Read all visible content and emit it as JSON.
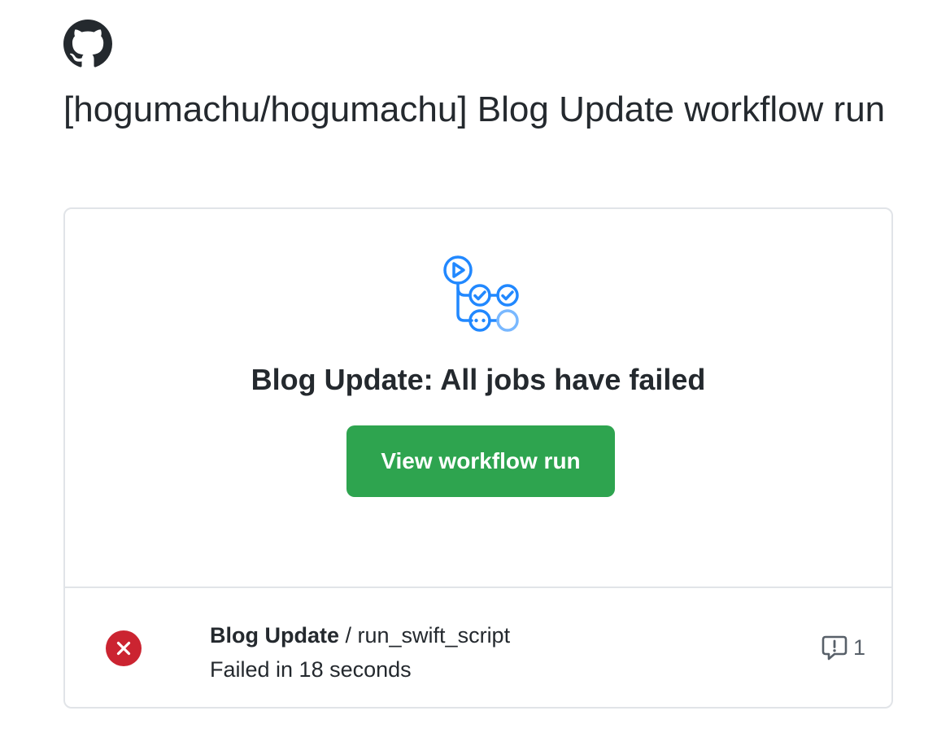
{
  "header": {
    "logo_icon": "github-mark-icon",
    "title": "[hogumachu/hogumachu] Blog Update workflow run"
  },
  "card": {
    "workflow_icon": "actions-workflow-icon",
    "headline": "Blog Update: All jobs have failed",
    "button_label": "View workflow run",
    "colors": {
      "button": "#2ea44f",
      "icon_primary": "#2188ff",
      "icon_secondary": "#79b8ff",
      "fail": "#cb2431"
    },
    "job": {
      "status_icon": "x-circle-fill-icon",
      "workflow_name": "Blog Update",
      "separator": " / ",
      "job_name": "run_swift_script",
      "status_text": "Failed in 18 seconds",
      "annotation_icon": "comment-exclamation-icon",
      "annotation_count": "1"
    }
  }
}
